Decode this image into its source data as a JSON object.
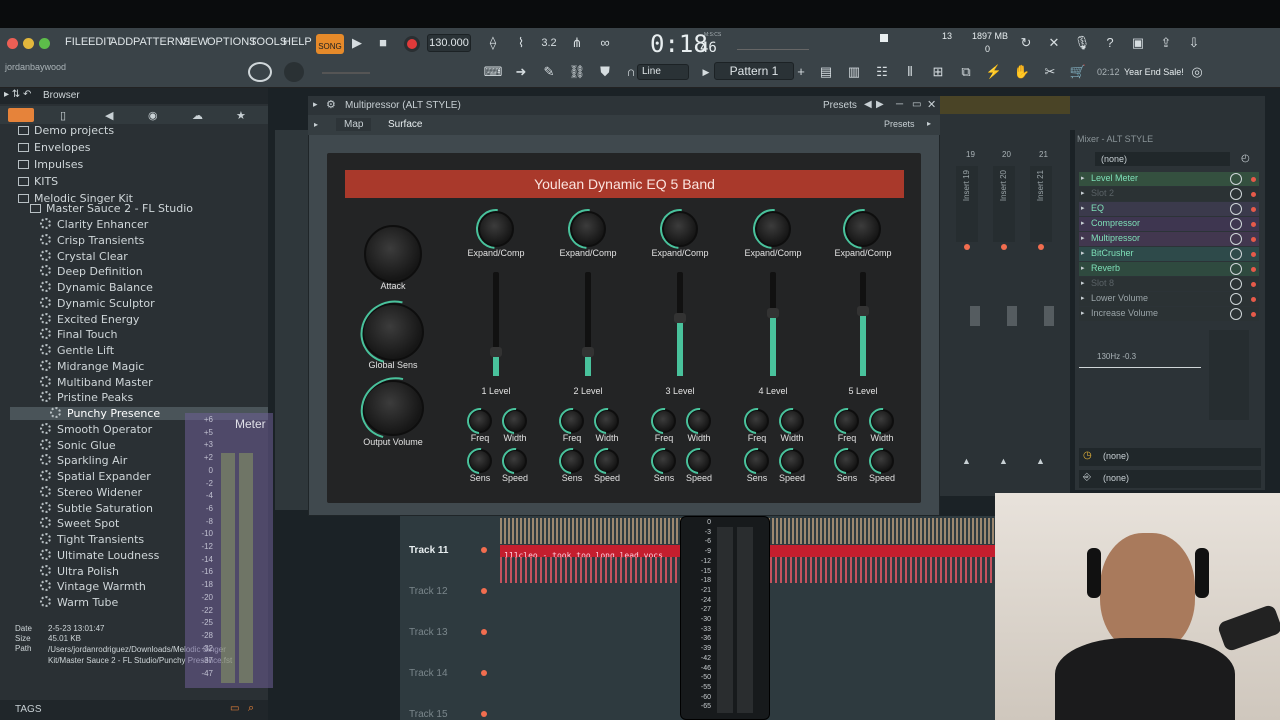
{
  "app": {
    "menu": [
      "FILE",
      "EDIT",
      "ADD",
      "PATTERNS",
      "VIEW",
      "OPTIONS",
      "TOOLS",
      "HELP"
    ],
    "song_mode": "SONG",
    "tempo": "130.000",
    "time": "0:18",
    "time_frac": "46",
    "time_unit": "M:S:CS",
    "cpu_value": "13",
    "memory": "1897 MB",
    "memory_sub": "0",
    "user": "jordanbaywood",
    "snap": "Line",
    "pattern": "Pattern 1",
    "hint_date": "02:12",
    "hint_text": "Year End Sale!"
  },
  "browser": {
    "title": "Browser",
    "folders": [
      "Demo projects",
      "Envelopes",
      "Impulses",
      "KITS",
      "Melodic Singer Kit"
    ],
    "subfolder": "Master Sauce 2 - FL Studio",
    "presets": [
      "Clarity Enhancer",
      "Crisp Transients",
      "Crystal Clear",
      "Deep Definition",
      "Dynamic Balance",
      "Dynamic Sculptor",
      "Excited Energy",
      "Final Touch",
      "Gentle Lift",
      "Midrange Magic",
      "Multiband Master",
      "Pristine Peaks",
      "Punchy Presence",
      "Smooth Operator",
      "Sonic Glue",
      "Sparkling Air",
      "Spatial Expander",
      "Stereo Widener",
      "Subtle Saturation",
      "Sweet Spot",
      "Tight Transients",
      "Ultimate Loudness",
      "Ultra Polish",
      "Vintage Warmth",
      "Warm Tube"
    ],
    "selected_index": 12,
    "info": {
      "date_label": "Date",
      "date": "2-5-23 13:01:47",
      "size_label": "Size",
      "size": "45.01 KB",
      "path_label": "Path",
      "path": "/Users/jordanrodriguez/Downloads/Melodic Singer Kit/Master Sauce 2 - FL Studio/Punchy Presence.fst"
    },
    "tags_label": "TAGS"
  },
  "plugin": {
    "window_title": "Multipressor (ALT STYLE)",
    "presets_label": "Presets",
    "tabs": [
      "Map",
      "Surface"
    ],
    "presets_label2": "Presets",
    "eq_title": "Youlean Dynamic EQ 5 Band",
    "left_knobs": [
      "Attack",
      "Global Sens",
      "Output Volume"
    ],
    "bands": [
      {
        "top": "Expand/Comp",
        "level": "1 Level",
        "freq": "Freq",
        "width": "Width",
        "sens": "Sens",
        "speed": "Speed",
        "fill": 0.22
      },
      {
        "top": "Expand/Comp",
        "level": "2 Level",
        "freq": "Freq",
        "width": "Width",
        "sens": "Sens",
        "speed": "Speed",
        "fill": 0.22
      },
      {
        "top": "Expand/Comp",
        "level": "3 Level",
        "freq": "Freq",
        "width": "Width",
        "sens": "Sens",
        "speed": "Speed",
        "fill": 0.55
      },
      {
        "top": "Expand/Comp",
        "level": "4 Level",
        "freq": "Freq",
        "width": "Width",
        "sens": "Sens",
        "speed": "Speed",
        "fill": 0.6
      },
      {
        "top": "Expand/Comp",
        "level": "5 Level",
        "freq": "Freq",
        "width": "Width",
        "sens": "Sens",
        "speed": "Speed",
        "fill": 0.62
      }
    ]
  },
  "mixer": {
    "title": "Mixer - ALT STYLE",
    "inserts": [
      "Insert 19",
      "Insert 20",
      "Insert 21"
    ],
    "insert_numbers": [
      "19",
      "20",
      "21"
    ],
    "preset": "(none)",
    "slots": [
      "Level Meter",
      "Slot 2",
      "EQ",
      "Compressor",
      "Multipressor",
      "BitCrusher",
      "Reverb",
      "Slot 8",
      "Lower Volume",
      "Increase Volume"
    ],
    "eq_readout": "130Hz -0.3",
    "out1": "(none)",
    "out2": "(none)"
  },
  "playlist": {
    "tracks": [
      "Track 11",
      "Track 12",
      "Track 13",
      "Track 14",
      "Track 15"
    ],
    "clip_label": "111cleo - took too long lead vocs"
  },
  "meter": {
    "title": "Meter",
    "ticks": [
      "+6",
      "+5",
      "+3",
      "+2",
      "0",
      "-2",
      "-4",
      "-6",
      "-8",
      "-10",
      "-12",
      "-14",
      "-16",
      "-18",
      "-20",
      "-22",
      "-25",
      "-28",
      "-32",
      "-37",
      "-47"
    ]
  },
  "meter2": {
    "ticks": [
      "0",
      "-3",
      "-6",
      "-9",
      "-12",
      "-15",
      "-18",
      "-21",
      "-24",
      "-27",
      "-30",
      "-33",
      "-36",
      "-39",
      "-42",
      "-46",
      "-50",
      "-55",
      "-60",
      "-65"
    ]
  },
  "colors": {
    "accent": "#49c29c",
    "eq_header": "#a9392b",
    "clip": "#e05663"
  }
}
